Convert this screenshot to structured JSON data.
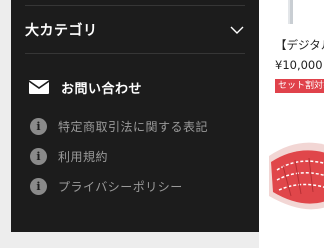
{
  "menu": {
    "category_label": "大カテゴリ",
    "contact_label": "お問い合わせ",
    "links": [
      "特定商取引法に関する表記",
      "利用規約",
      "プライバシーポリシー"
    ],
    "info_glyph": "i"
  },
  "product": {
    "title": "【デジタル",
    "price": "¥10,000",
    "badge": "セット割対象"
  },
  "icons": {
    "category_toggle": "chevron-down-icon",
    "contact": "envelope-icon",
    "link": "info-icon"
  },
  "colors": {
    "drawer_bg": "#1c1c1c",
    "badge_bg": "#e0424b"
  }
}
